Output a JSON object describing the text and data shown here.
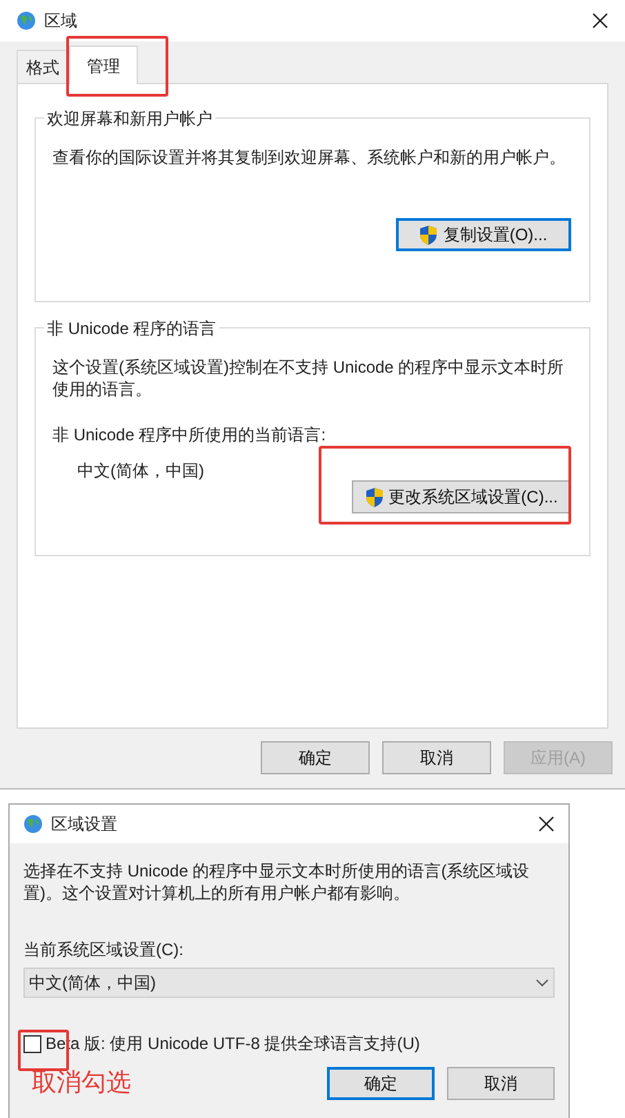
{
  "region_dialog": {
    "title": "区域",
    "tabs": [
      {
        "label": "格式",
        "selected": false
      },
      {
        "label": "管理",
        "selected": true
      }
    ],
    "welcome_group": {
      "title": "欢迎屏幕和新用户帐户",
      "description": "查看你的国际设置并将其复制到欢迎屏幕、系统帐户和新的用户帐户。",
      "button": {
        "label": "复制设置(O)...",
        "focused": true
      }
    },
    "non_unicode_group": {
      "title": "非 Unicode 程序的语言",
      "description": "这个设置(系统区域设置)控制在不支持 Unicode 的程序中显示文本时所使用的语言。",
      "current_label": "非 Unicode 程序中所使用的当前语言:",
      "current_value": "中文(简体，中国)",
      "button": {
        "label": "更改系统区域设置(C)...",
        "focused": false
      }
    },
    "buttons": [
      {
        "label": "确定",
        "disabled": false
      },
      {
        "label": "取消",
        "disabled": false
      },
      {
        "label": "应用(A)",
        "disabled": true
      }
    ]
  },
  "region_settings_dialog": {
    "title": "区域设置",
    "description": "选择在不支持 Unicode 的程序中显示文本时所使用的语言(系统区域设置)。这个设置对计算机上的所有用户帐户都有影响。",
    "select_label": "当前系统区域设置(C):",
    "select_value": "中文(简体，中国)",
    "checkbox": {
      "label": "Beta 版: 使用 Unicode UTF-8 提供全球语言支持(U)",
      "checked": false
    },
    "annotation": "取消勾选",
    "buttons": [
      {
        "label": "确定",
        "focused": true
      },
      {
        "label": "取消",
        "focused": false
      }
    ]
  }
}
